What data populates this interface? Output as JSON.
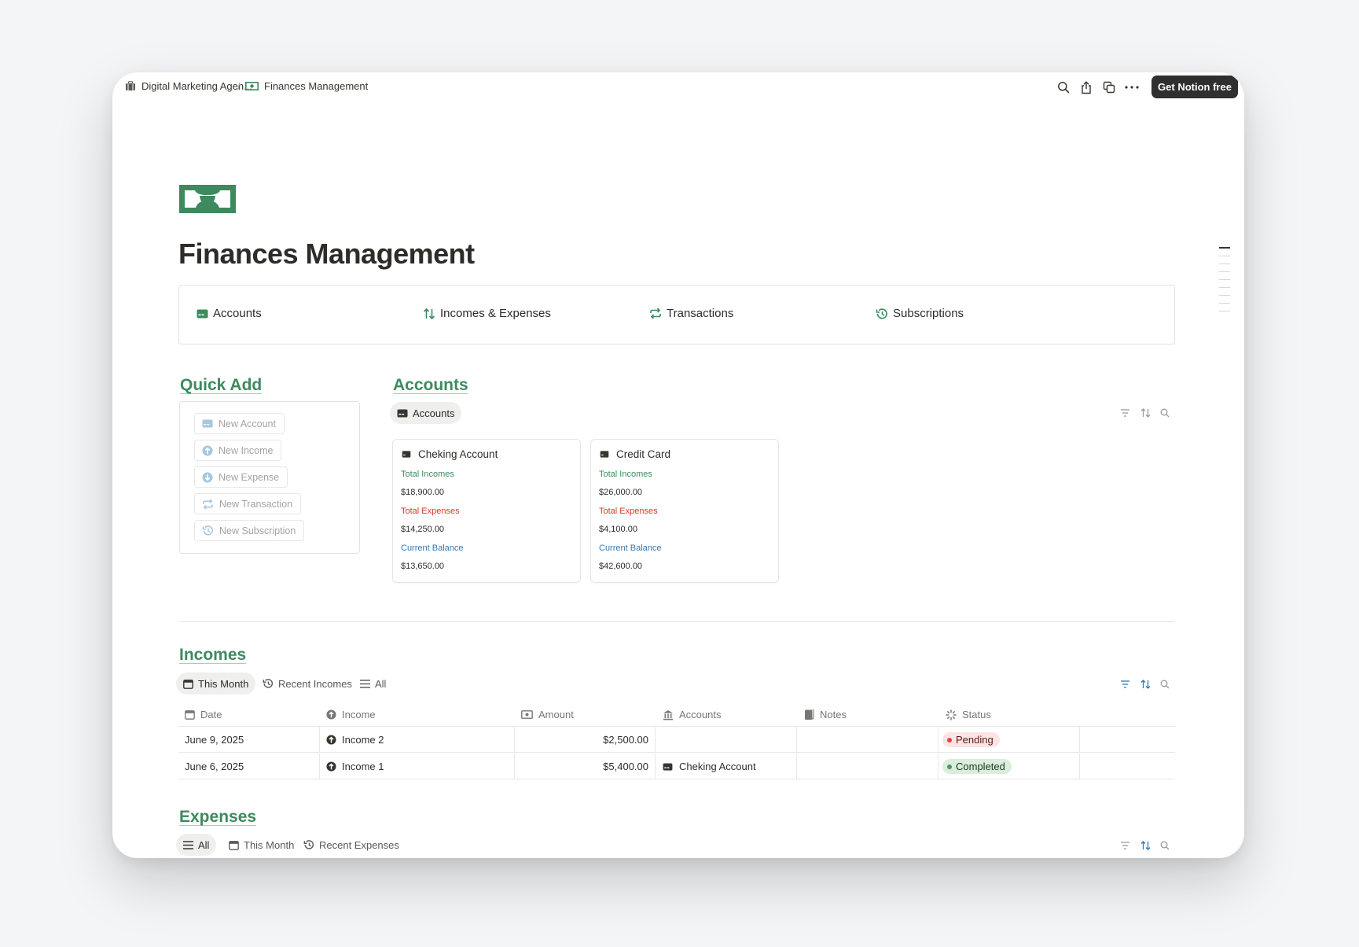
{
  "topbar": {
    "breadcrumb_1": "Digital Marketing Agen...",
    "breadcrumb_sep": "/",
    "breadcrumb_2": "Finances Management",
    "get_notion": "Get Notion free"
  },
  "page": {
    "title": "Finances Management",
    "accent_color": "#3d8a5e"
  },
  "nav": {
    "accounts": "Accounts",
    "incomes_expenses": "Incomes & Expenses",
    "transactions": "Transactions",
    "subscriptions": "Subscriptions"
  },
  "quick_add": {
    "title": "Quick Add",
    "buttons": [
      "New Account",
      "New Income",
      "New Expense",
      "New Transaction",
      "New Subscription"
    ]
  },
  "accounts": {
    "title": "Accounts",
    "view_tab": "Accounts",
    "cards": [
      {
        "name": "Cheking Account",
        "total_incomes_label": "Total Incomes",
        "total_incomes": "$18,900.00",
        "total_expenses_label": "Total Expenses",
        "total_expenses": "$14,250.00",
        "balance_label": "Current Balance",
        "balance": "$13,650.00"
      },
      {
        "name": "Credit Card",
        "total_incomes_label": "Total Incomes",
        "total_incomes": "$26,000.00",
        "total_expenses_label": "Total Expenses",
        "total_expenses": "$4,100.00",
        "balance_label": "Current Balance",
        "balance": "$42,600.00"
      }
    ]
  },
  "incomes": {
    "title": "Incomes",
    "tabs": [
      "This Month",
      "Recent Incomes",
      "All"
    ],
    "columns": [
      "Date",
      "Income",
      "Amount",
      "Accounts",
      "Notes",
      "Status"
    ],
    "rows": [
      {
        "date": "June 9, 2025",
        "income": "Income 2",
        "amount": "$2,500.00",
        "account": "",
        "notes": "",
        "status": "Pending"
      },
      {
        "date": "June 6, 2025",
        "income": "Income 1",
        "amount": "$5,400.00",
        "account": "Cheking Account",
        "notes": "",
        "status": "Completed"
      }
    ]
  },
  "expenses": {
    "title": "Expenses",
    "tabs": [
      "All",
      "This Month",
      "Recent Expenses"
    ]
  }
}
